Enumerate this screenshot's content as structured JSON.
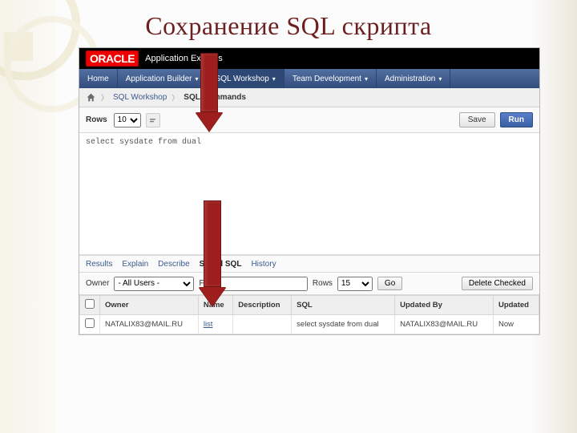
{
  "slide": {
    "title": "Сохранение SQL скрипта"
  },
  "blackbar": {
    "brand": "ORACLE",
    "app": "Application Express"
  },
  "mainnav": {
    "items": [
      {
        "label": "Home"
      },
      {
        "label": "Application Builder",
        "caret": true
      },
      {
        "label": "SQL Workshop",
        "caret": true,
        "selected": true
      },
      {
        "label": "Team Development",
        "caret": true
      },
      {
        "label": "Administration",
        "caret": true
      }
    ]
  },
  "crumbs": {
    "a": "SQL Workshop",
    "b": "SQL Commands"
  },
  "toolbar": {
    "rows_label": "Rows",
    "rows_value": "10",
    "save_label": "Save",
    "run_label": "Run"
  },
  "sql": {
    "text": "select sysdate from dual"
  },
  "restabs": {
    "a": "Results",
    "b": "Explain",
    "c": "Describe",
    "d": "Saved SQL",
    "e": "History"
  },
  "filter": {
    "owner_label": "Owner",
    "owner_value": "- All Users -",
    "find_label": "Find",
    "find_value": "",
    "rows_label": "Rows",
    "rows_value": "15",
    "go_label": "Go",
    "delete_label": "Delete Checked"
  },
  "grid": {
    "cols": {
      "owner": "Owner",
      "name": "Name",
      "desc": "Description",
      "sql": "SQL",
      "by": "Updated By",
      "updated": "Updated"
    },
    "row1": {
      "owner": "NATALIX83@MAIL.RU",
      "name": "list",
      "desc": "",
      "sql": "select sysdate from dual",
      "by": "NATALIX83@MAIL.RU",
      "updated": "Now"
    }
  }
}
